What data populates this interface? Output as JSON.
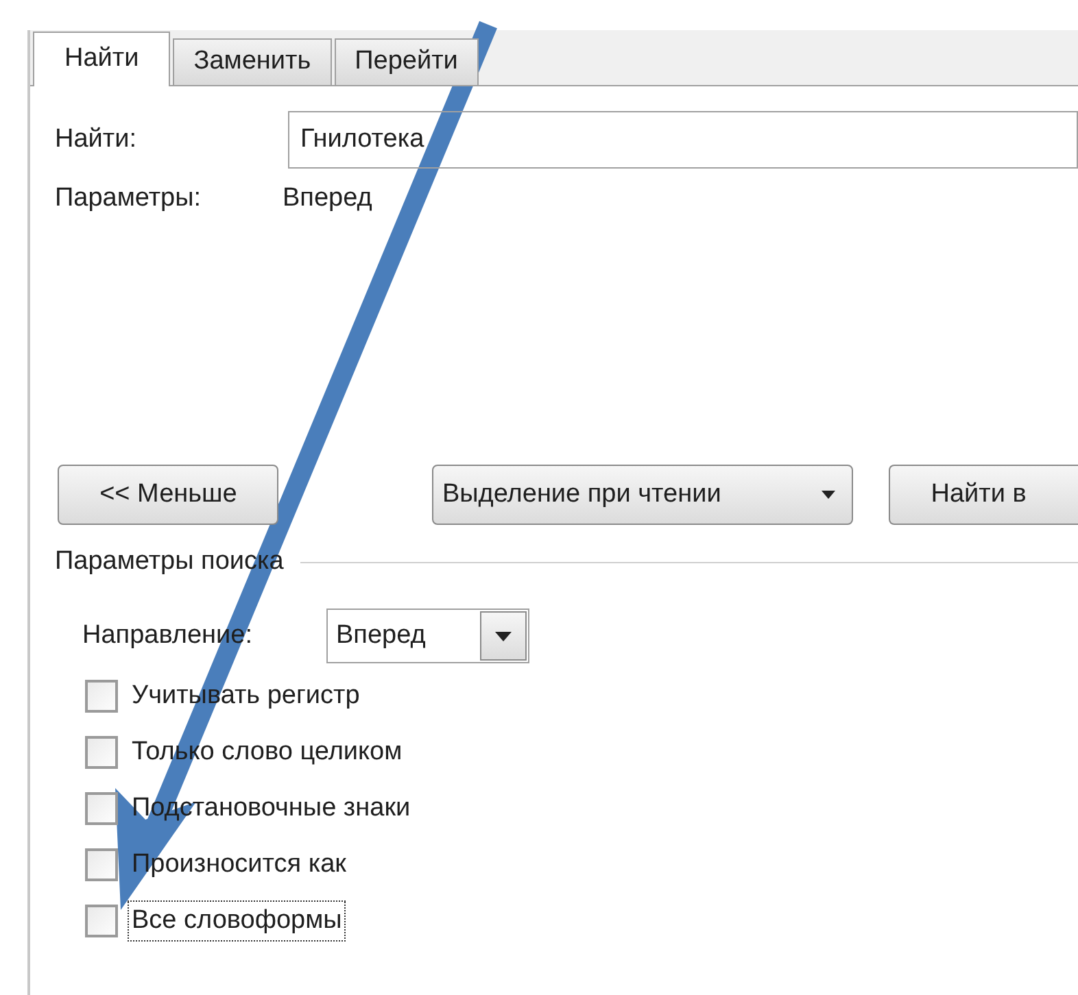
{
  "tabs": [
    {
      "label": "Найти",
      "selected": true
    },
    {
      "label": "Заменить",
      "selected": false
    },
    {
      "label": "Перейти",
      "selected": false
    }
  ],
  "find": {
    "label": "Найти:",
    "value": "Гнилотека"
  },
  "options_line": {
    "label": "Параметры:",
    "value": "Вперед"
  },
  "buttons": {
    "less": "<< Меньше",
    "reading_highlight": "Выделение при чтении",
    "find_in": "Найти в"
  },
  "search_options": {
    "title": "Параметры поиска",
    "direction_label": "Направление:",
    "direction_value": "Вперед",
    "checkboxes": [
      {
        "label": "Учитывать регистр",
        "checked": false,
        "focused": false
      },
      {
        "label": "Только слово целиком",
        "checked": false,
        "focused": false
      },
      {
        "label": "Подстановочные знаки",
        "checked": false,
        "focused": false
      },
      {
        "label": "Произносится как",
        "checked": false,
        "focused": false
      },
      {
        "label": "Все словоформы",
        "checked": false,
        "focused": true
      }
    ]
  }
}
